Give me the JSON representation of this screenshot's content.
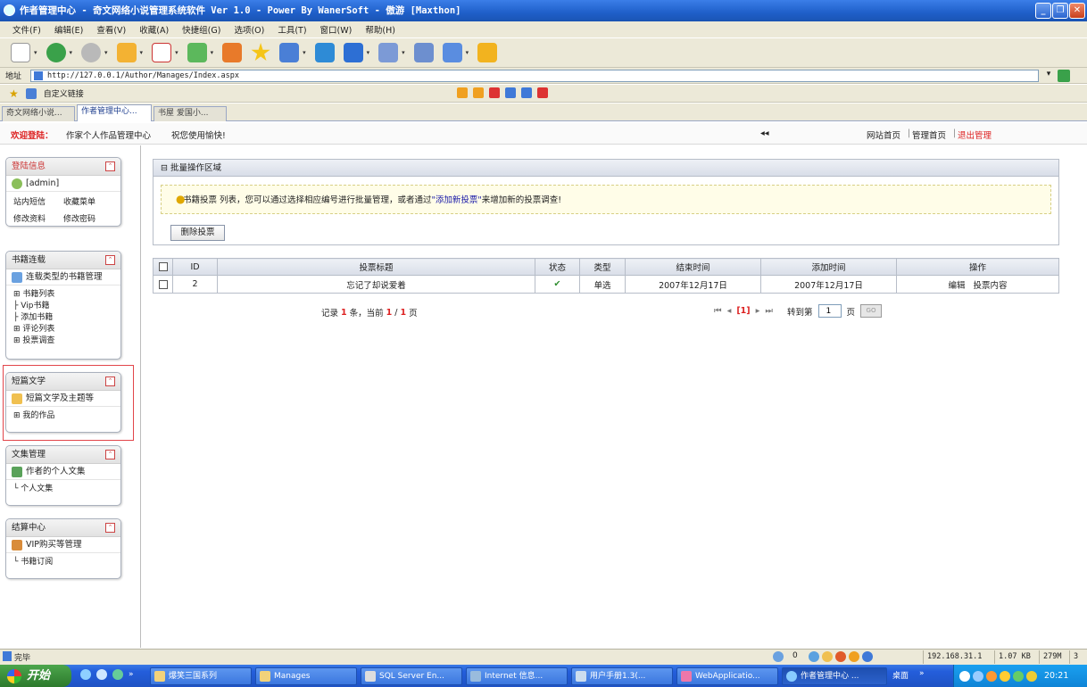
{
  "window": {
    "title": "作者管理中心 - 奇文网络小说管理系统软件 Ver 1.0 - Power By WanerSoft - 傲游 [Maxthon]"
  },
  "menu": [
    "文件(F)",
    "编辑(E)",
    "查看(V)",
    "收藏(A)",
    "快捷组(G)",
    "选项(O)",
    "工具(T)",
    "窗口(W)",
    "帮助(H)"
  ],
  "address": {
    "label": "地址",
    "url": "http://127.0.0.1/Author/Manages/Index.aspx"
  },
  "favbar": {
    "label": "自定义链接"
  },
  "tabs": [
    "奇文网络小说...",
    "作者管理中心...",
    "书屋 爱国小..."
  ],
  "welcome": {
    "label": "欢迎登陆：",
    "text1": "作家个人作品管理中心",
    "text2": "祝您使用愉快!",
    "collapse": "◂◂",
    "links": [
      "网站首页",
      "管理首页",
      "退出管理"
    ]
  },
  "sidebar": {
    "login": {
      "title": "登陆信息",
      "user": "[admin]",
      "links": [
        "站内短信",
        "收藏菜单",
        "修改资料",
        "修改密码"
      ]
    },
    "books": {
      "title": "书籍连载",
      "sub": "连载类型的书籍管理",
      "items": [
        "书籍列表",
        "Vip书籍",
        "添加书籍",
        "评论列表",
        "投票调查"
      ]
    },
    "short": {
      "title": "短篇文学",
      "sub": "短篇文学及主题等",
      "items": [
        "我的作品"
      ]
    },
    "docs": {
      "title": "文集管理",
      "sub": "作者的个人文集",
      "items": [
        "个人文集"
      ]
    },
    "settle": {
      "title": "结算中心",
      "sub": "VIP购买等管理",
      "items": [
        "书籍订阅"
      ]
    }
  },
  "panel": {
    "title": "批量操作区域",
    "tip_prefix": "书籍投票 列表，您可以通过选择相应编号进行批量管理，或者通过",
    "tip_link": "\"添加新投票\"",
    "tip_suffix": "来增加新的投票调查!",
    "delete_btn": "删除投票"
  },
  "grid": {
    "headers": [
      "ID",
      "投票标题",
      "状态",
      "类型",
      "结束时间",
      "添加时间",
      "操作"
    ],
    "rows": [
      {
        "id": "2",
        "title": "忘记了却说爱着",
        "status": "✔",
        "type": "单选",
        "end": "2007年12月17日",
        "added": "2007年12月17日",
        "ops": [
          "编辑",
          "投票内容"
        ]
      }
    ]
  },
  "pager": {
    "rec1": "记录",
    "count": "1",
    "rec2": "条，当前",
    "cur": "1",
    "sep": "/",
    "total": "1",
    "rec3": "页",
    "nav_first": "⏮",
    "nav_prev": "◂",
    "page_link": "[1]",
    "nav_next": "▸",
    "nav_last": "⏭",
    "jump": "转到第",
    "page_input": "1",
    "page_unit": "页",
    "go": "GO"
  },
  "status": {
    "text": "完毕",
    "count": "0",
    "ip": "192.168.31.1",
    "size": "1.07 KB",
    "mem": "279M",
    "num": "3"
  },
  "taskbar": {
    "start": "开始",
    "tasks": [
      "爆笑三国系列",
      "Manages",
      "SQL Server En...",
      "Internet 信息...",
      "用户手册1.3(...",
      "WebApplicatio...",
      "作者管理中心 ...",
      "桌面"
    ],
    "time": "20:21"
  },
  "colors": {
    "accent": "#1f5fc9",
    "red": "#d22",
    "link": "#1a1aa8"
  }
}
